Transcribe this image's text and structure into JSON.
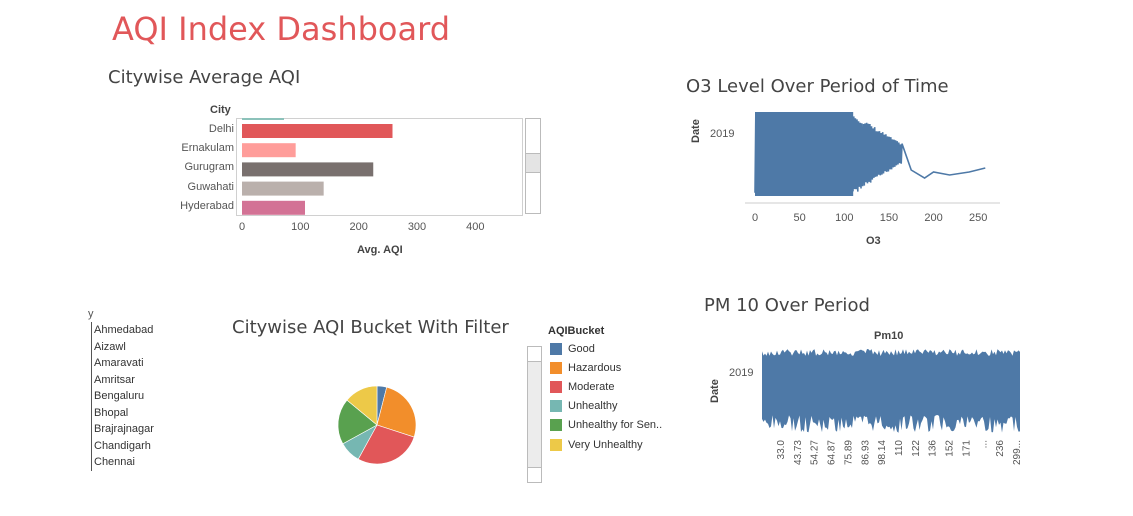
{
  "dashboard": {
    "title": "AQI Index Dashboard"
  },
  "bar_sheet": {
    "title": "Citywise Average AQI",
    "row_header": "City"
  },
  "o3_sheet": {
    "title": "O3 Level Over Period of Time"
  },
  "pie_sheet": {
    "title": "Citywise AQI Bucket With Filter",
    "filter_header": "y",
    "filter_cities": [
      "Ahmedabad",
      "Aizawl",
      "Amaravati",
      "Amritsar",
      "Bengaluru",
      "Bhopal",
      "Brajrajnagar",
      "Chandigarh",
      "Chennai"
    ]
  },
  "pm10_sheet": {
    "title": "PM 10 Over Period"
  },
  "legend": {
    "title": "AQIBucket",
    "items": [
      {
        "label": "Good",
        "color": "#4e79a7"
      },
      {
        "label": "Hazardous",
        "color": "#f28e2b"
      },
      {
        "label": "Moderate",
        "color": "#e15759"
      },
      {
        "label": "Unhealthy",
        "color": "#76b7b2"
      },
      {
        "label": "Unhealthy for Sen..",
        "color": "#59a14f"
      },
      {
        "label": "Very Unhealthy",
        "color": "#edc948"
      }
    ]
  },
  "chart_data": [
    {
      "type": "bar",
      "orientation": "horizontal",
      "title": "Citywise Average AQI",
      "ylabel": "City",
      "xlabel": "Avg. AQI",
      "xlim": [
        0,
        480
      ],
      "xticks": [
        "0",
        "100",
        "200",
        "300",
        "400"
      ],
      "categories": [
        "Delhi",
        "Ernakulam",
        "Gurugram",
        "Guwahati",
        "Hyderabad"
      ],
      "values": [
        258,
        92,
        225,
        140,
        108
      ],
      "colors": [
        "#e15759",
        "#ff9d9a",
        "#79706e",
        "#bab0ac",
        "#d37295"
      ],
      "partial_top_bar": {
        "value": 72,
        "color": "#8cc2ba"
      }
    },
    {
      "type": "line",
      "title": "O3 Level Over Period of Time",
      "xlabel": "O3",
      "ylabel": "Date",
      "xlim": [
        0,
        270
      ],
      "xticks": [
        "0",
        "50",
        "100",
        "150",
        "200",
        "250"
      ],
      "yticks": [
        "2019"
      ],
      "color": "#4e79a7"
    },
    {
      "type": "pie",
      "title": "Citywise AQI Bucket With Filter",
      "categories": [
        "Good",
        "Hazardous",
        "Moderate",
        "Unhealthy",
        "Unhealthy for Sen..",
        "Very Unhealthy"
      ],
      "values": [
        4,
        26,
        28,
        9,
        19,
        14
      ],
      "colors": [
        "#4e79a7",
        "#f28e2b",
        "#e15759",
        "#76b7b2",
        "#59a14f",
        "#edc948"
      ]
    },
    {
      "type": "area",
      "title": "Pm10",
      "xlabel": "",
      "ylabel": "Date",
      "yticks": [
        "2019"
      ],
      "xticks": [
        "33.0",
        "43.73",
        "54.27",
        "64.87",
        "75.89",
        "86.93",
        "98.14",
        "110",
        "122",
        "136",
        "152",
        "171",
        "...",
        "236",
        "299..."
      ],
      "color": "#4e79a7"
    }
  ]
}
